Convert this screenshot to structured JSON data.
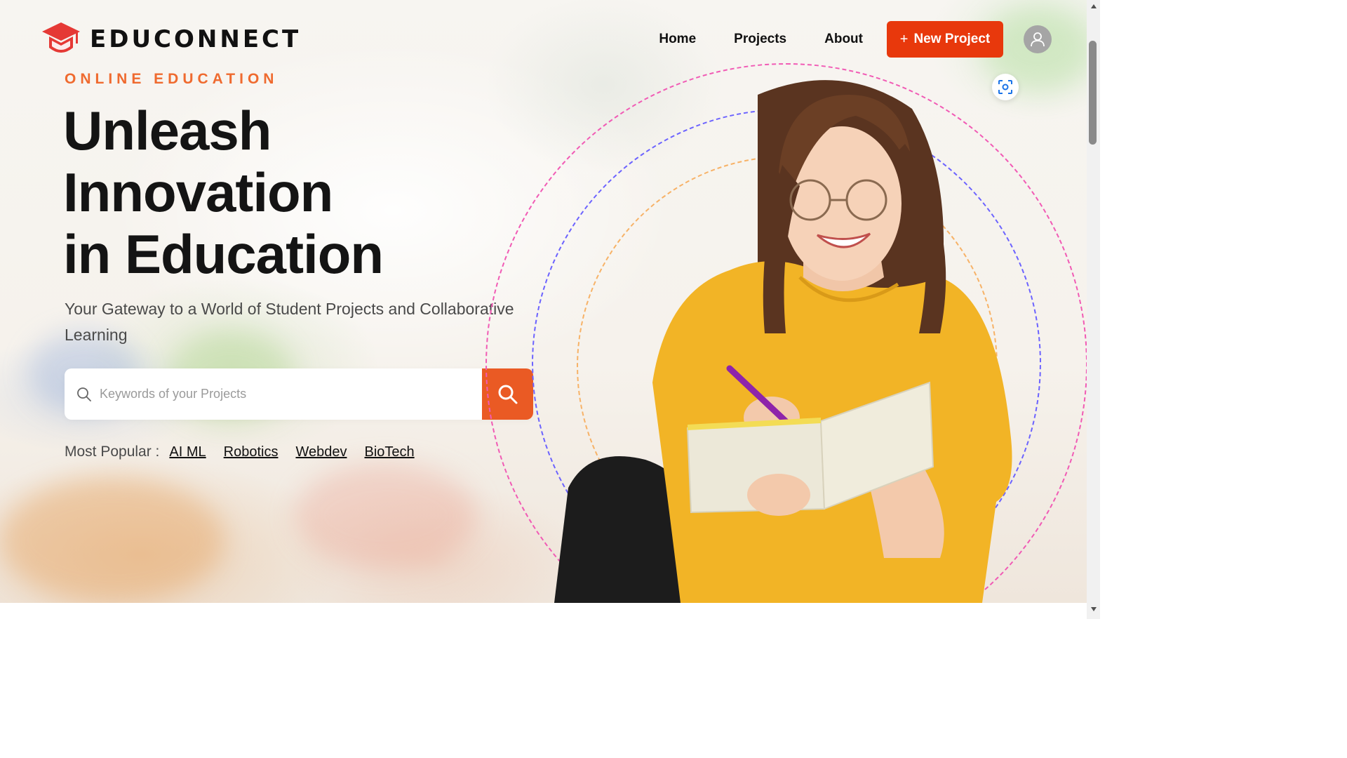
{
  "brand": {
    "name": "EDUCONNECT",
    "accent": "#e8380c"
  },
  "nav": {
    "items": [
      "Home",
      "Projects",
      "About"
    ],
    "new_project_label": "New Project",
    "new_project_icon": "plus-icon",
    "avatar_icon": "user-icon"
  },
  "hero": {
    "eyebrow": "ONLINE EDUCATION",
    "title_lines": [
      "Unleash",
      "Innovation",
      "in Education"
    ],
    "subtitle": "Your Gateway to a World of Student Projects and Collaborative Learning"
  },
  "search": {
    "placeholder": "Keywords of your Projects",
    "button_icon": "search-icon"
  },
  "popular": {
    "label": "Most Popular :",
    "tags": [
      "AI ML",
      "Robotics",
      "Webdev",
      "BioTech"
    ]
  },
  "colors": {
    "eyebrow": "#ef6a2f",
    "search_button": "#ea5a24",
    "ring_pink": "#f15bb5",
    "ring_blue": "#6c63ff",
    "ring_orange": "#f7b267"
  }
}
